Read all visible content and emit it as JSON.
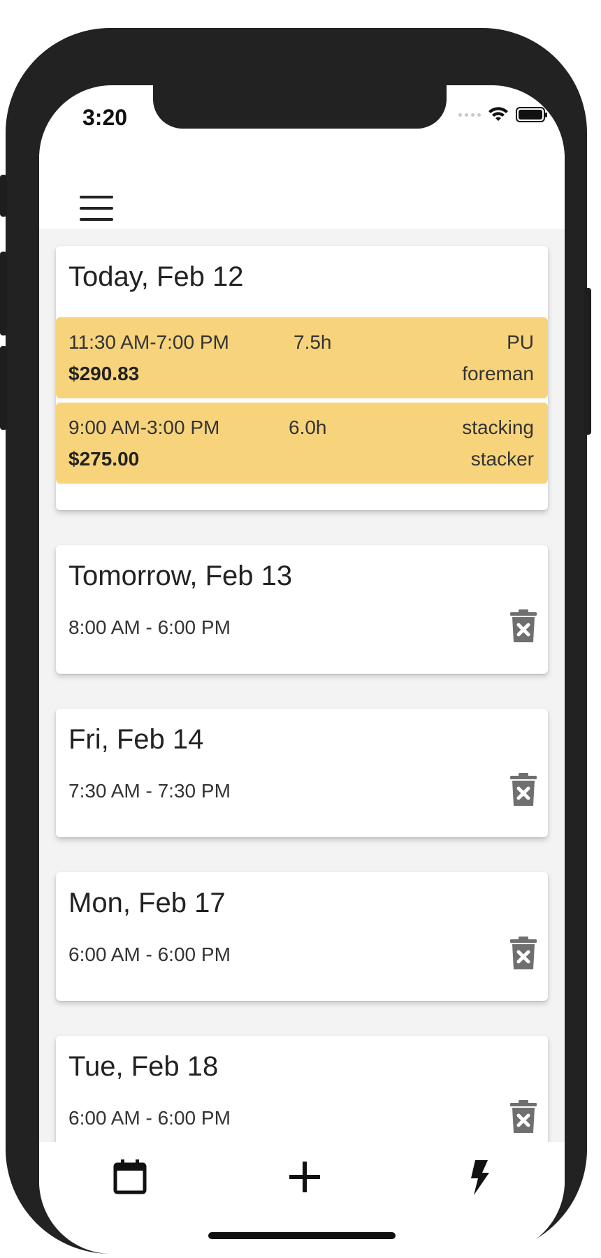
{
  "status_bar": {
    "time": "3:20"
  },
  "header": {
    "menu_icon": "hamburger-menu-icon"
  },
  "today_card": {
    "title": "Today, Feb 12",
    "shifts": [
      {
        "time": "11:30 AM-7:00 PM",
        "hours": "7.5h",
        "location": "PU",
        "pay": "$290.83",
        "role": "foreman"
      },
      {
        "time": "9:00 AM-3:00 PM",
        "hours": "6.0h",
        "location": "stacking",
        "pay": "$275.00",
        "role": "stacker"
      }
    ]
  },
  "availability_cards": [
    {
      "title": "Tomorrow, Feb 13",
      "time": "8:00 AM - 6:00 PM"
    },
    {
      "title": "Fri, Feb 14",
      "time": "7:30 AM - 7:30 PM"
    },
    {
      "title": "Mon, Feb 17",
      "time": "6:00 AM - 6:00 PM"
    },
    {
      "title": "Tue, Feb 18",
      "time": "6:00 AM - 6:00 PM"
    }
  ],
  "tab_bar": {
    "icons": [
      "calendar-icon",
      "plus-icon",
      "lightning-icon"
    ]
  },
  "colors": {
    "shift_highlight": "#f7d47c",
    "background": "#f3f3f3",
    "frame": "#222222"
  }
}
